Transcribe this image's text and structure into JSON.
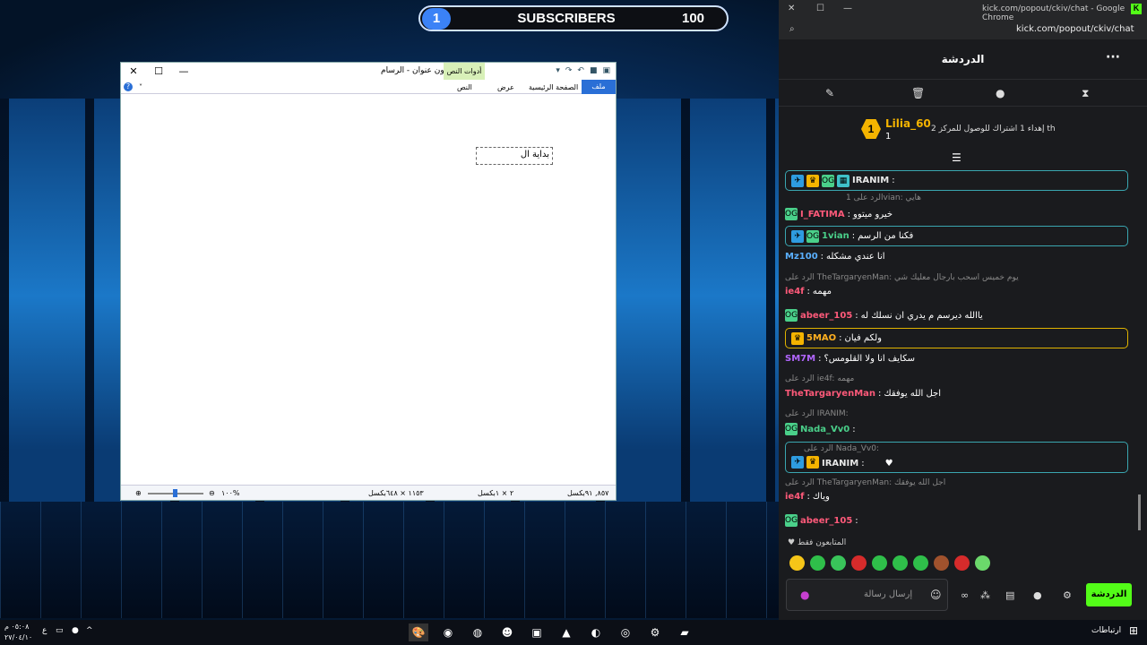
{
  "overlay": {
    "count_left": "1",
    "label": "SUBSCRIBERS",
    "count_right": "100"
  },
  "paint": {
    "title": "بدون عنوان - الرسام",
    "tools_tab": "أدوات النص",
    "tab_file": "ملف",
    "tab_home": "الصفحة الرئيسية",
    "tab_view": "عرض",
    "tab_text": "النص",
    "textbox": "بداية ال",
    "status_pos": "٨٥٧, ٩١بكسل",
    "status_sel": "٢ × ١بكسل",
    "status_size": "١١٥٣ × ٦٤٨بكسل",
    "zoom": "١٠٠%"
  },
  "chrome": {
    "tab_url": "kick.com/popout/ckiv/chat - Google Chrome",
    "address": "kick.com/popout/ckiv/chat"
  },
  "chat": {
    "header": "الدردشة",
    "pinned": {
      "rank": "1",
      "user": "Lilia_60",
      "subs": "1",
      "text": "إهداء 1 اشتراك للوصول للمركز 2 th"
    },
    "messages": [
      {
        "user": "IRANIM",
        "text": "",
        "boxed": "teal",
        "reply": "",
        "ucolor": "#e8e8e8"
      },
      {
        "user": "I_FATIMA",
        "text": "خيرو ميتوو",
        "reply": "الرد على 1vian: هايي",
        "ucolor": "#ff5a7a"
      },
      {
        "user": "1vian",
        "text": "فكنا من الرسم",
        "boxed": "teal",
        "reply": "",
        "ucolor": "#4ad08a"
      },
      {
        "user": "Mz100",
        "text": "انا عندي مشكله",
        "reply": "",
        "ucolor": "#5ab0ff"
      },
      {
        "user": "ie4f",
        "text": "مهمه",
        "reply": "الرد على TheTargaryenMan: يوم خميس اسحب بارجال معليك شي",
        "ucolor": "#ff5a7a"
      },
      {
        "user": "abeer_105",
        "text": "ياالله ديرسم م يدري ان نسلك له",
        "reply": "",
        "ucolor": "#ff5a7a"
      },
      {
        "user": "5MAO",
        "text": "ولكم فيان",
        "boxed": "gold",
        "reply": "",
        "ucolor": "#ffb020"
      },
      {
        "user": "SM7M",
        "text": "سكايف انا ولا القلومس؟",
        "reply": "",
        "ucolor": "#b266ff"
      },
      {
        "user": "TheTargaryenMan",
        "text": "اجل الله يوفقك",
        "reply": "الرد على ie4f: مهمه",
        "ucolor": "#ff5a7a"
      },
      {
        "user": "Nada_Vv0",
        "text": "",
        "reply": "الرد على IRANIM:",
        "ucolor": "#4ad08a"
      },
      {
        "user": "IRANIM",
        "text": "",
        "boxed": "teal",
        "reply": "الرد على Nada_Vv0:",
        "ucolor": "#e8e8e8"
      },
      {
        "user": "ie4f",
        "text": "وياك",
        "reply": "الرد على TheTargaryenMan: اجل الله يوفقك",
        "ucolor": "#ff5a7a"
      },
      {
        "user": "abeer_105",
        "text": "",
        "reply": "",
        "ucolor": "#ff5a7a"
      }
    ],
    "followers_only": "المتابعون فقط",
    "input_placeholder": "إرسال رسالة",
    "send_label": "الدردشة"
  },
  "taskbar": {
    "time": "٠٥:٠٨ م",
    "date": "٢٧/٠٤/١٠",
    "lang": "ع",
    "search": "ارتباطات"
  }
}
